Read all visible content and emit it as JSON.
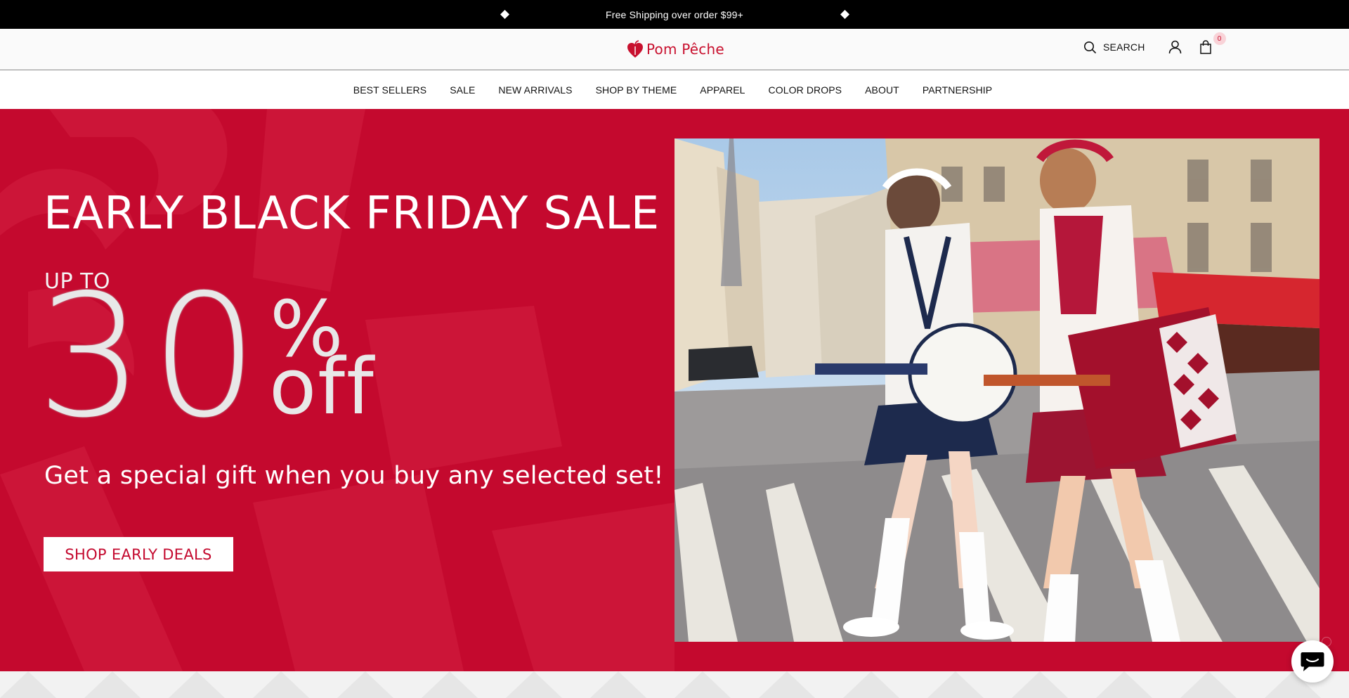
{
  "announcement": {
    "message": "Free Shipping over order $99+",
    "prev_icon": "diamond-icon",
    "next_icon": "diamond-icon"
  },
  "header": {
    "logo_text": "Pom Pêche",
    "logo_icon": "heart-peach-icon",
    "search_label": "SEARCH",
    "cart_count": "0",
    "icons": [
      "search-icon",
      "account-icon",
      "cart-bag-icon"
    ]
  },
  "nav": {
    "items": [
      {
        "label": "BEST SELLERS"
      },
      {
        "label": "SALE"
      },
      {
        "label": "NEW ARRIVALS"
      },
      {
        "label": "SHOP BY THEME"
      },
      {
        "label": "APPAREL"
      },
      {
        "label": "COLOR DROPS"
      },
      {
        "label": "ABOUT"
      },
      {
        "label": "PARTNERSHIP"
      }
    ]
  },
  "hero": {
    "title": "EARLY BLACK FRIDAY SALE",
    "upto": "UP TO",
    "number": "30",
    "percent": "%",
    "off": "off",
    "subtitle": "Get a special gift when you buy any selected set!",
    "cta_label": "SHOP EARLY DEALS",
    "colors": {
      "background": "#c4092e",
      "text": "#ffffff",
      "cta_text": "#c4092e"
    }
  },
  "chat": {
    "icon": "chat-bubble-icon"
  }
}
